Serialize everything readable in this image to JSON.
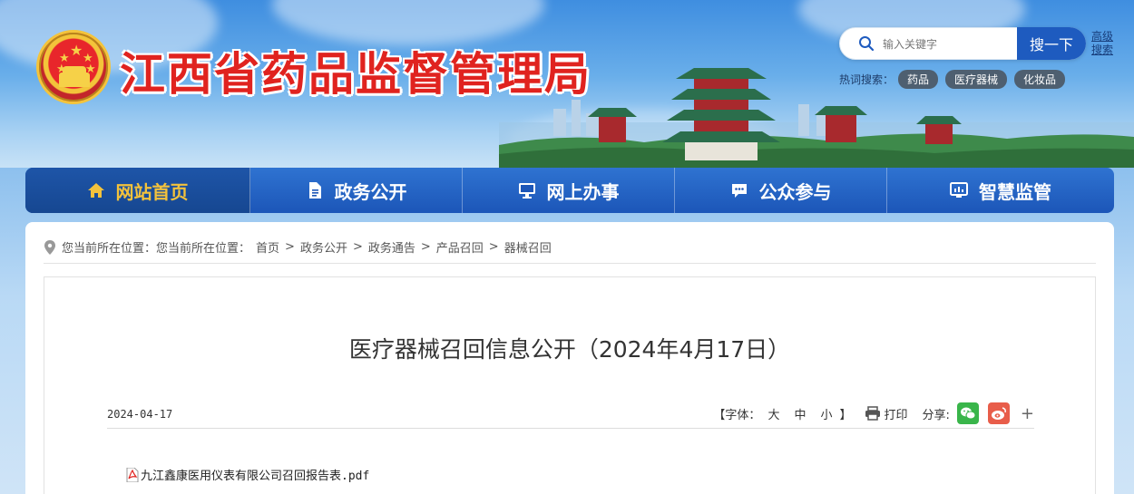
{
  "header": {
    "site_title": "江西省药品监督管理局",
    "search": {
      "placeholder": "输入关键字",
      "button_label": "搜一下",
      "advanced_label": "高级搜索"
    },
    "hot_search": {
      "label": "热词搜索：",
      "tags": [
        "药品",
        "医疗器械",
        "化妆品"
      ]
    }
  },
  "nav": {
    "items": [
      {
        "label": "网站首页",
        "icon": "home-icon",
        "active": true
      },
      {
        "label": "政务公开",
        "icon": "document-icon"
      },
      {
        "label": "网上办事",
        "icon": "monitor-icon"
      },
      {
        "label": "公众参与",
        "icon": "chat-icon"
      },
      {
        "label": "智慧监管",
        "icon": "dashboard-icon"
      }
    ]
  },
  "breadcrumb": {
    "prefix": "您当前所在位置：您当前所在位置：",
    "items": [
      "首页",
      "政务公开",
      "政务通告",
      "产品召回",
      "器械召回"
    ],
    "separator": ">"
  },
  "article": {
    "title": "医疗器械召回信息公开（2024年4月17日）",
    "date": "2024-04-17",
    "font_control": {
      "open": "【字体：",
      "large": "大",
      "medium": "中",
      "small": "小",
      "close": "】"
    },
    "print_label": "打印",
    "share_label": "分享:",
    "share_more": "+",
    "attachment": "九江鑫康医用仪表有限公司召回报告表.pdf"
  },
  "colors": {
    "title_red": "#e0231f",
    "nav_blue": "#1c56b8",
    "nav_active_text": "#f3c23c",
    "search_button": "#1e5bbf"
  }
}
